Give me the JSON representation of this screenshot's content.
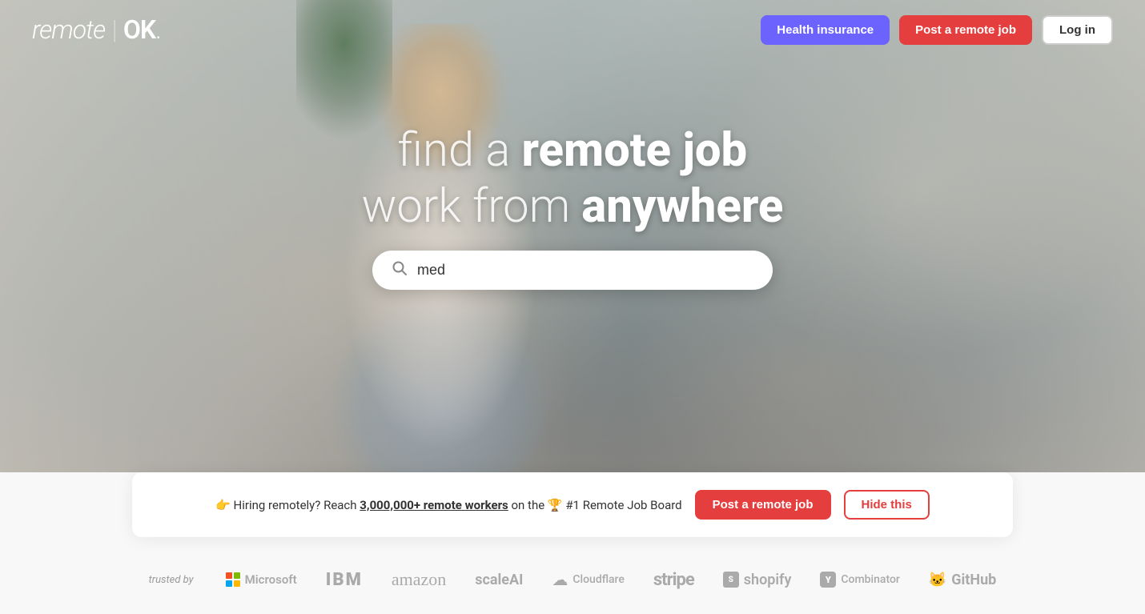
{
  "nav": {
    "logo": "remote | OK.",
    "health_insurance_label": "Health insurance",
    "post_job_label": "Post a remote job",
    "login_label": "Log in"
  },
  "hero": {
    "title_line1": "find a remote job",
    "title_line1_plain": "find a ",
    "title_line1_bold": "remote job",
    "title_line2_plain": "work from ",
    "title_line2_bold": "anywhere"
  },
  "search": {
    "placeholder": "med",
    "value": "med"
  },
  "banner": {
    "emoji_point": "👉",
    "text_plain": " Hiring remotely? Reach ",
    "text_bold": "3,000,000+ remote workers",
    "text_suffix": " on the ",
    "emoji_trophy": "🏆",
    "text_board": " #1 Remote Job Board",
    "post_label": "Post a remote job",
    "hide_label": "Hide this"
  },
  "trusted": {
    "label": "trusted by",
    "logos": [
      {
        "name": "Microsoft",
        "type": "microsoft"
      },
      {
        "name": "IBM",
        "type": "ibm"
      },
      {
        "name": "amazon",
        "type": "amazon"
      },
      {
        "name": "scaleAI",
        "type": "scaleai"
      },
      {
        "name": "Cloudflare",
        "type": "cloudflare"
      },
      {
        "name": "stripe",
        "type": "stripe"
      },
      {
        "name": "shopify",
        "type": "shopify"
      },
      {
        "name": "Y Combinator",
        "type": "ycombinator"
      },
      {
        "name": "GitHub",
        "type": "github"
      }
    ]
  }
}
